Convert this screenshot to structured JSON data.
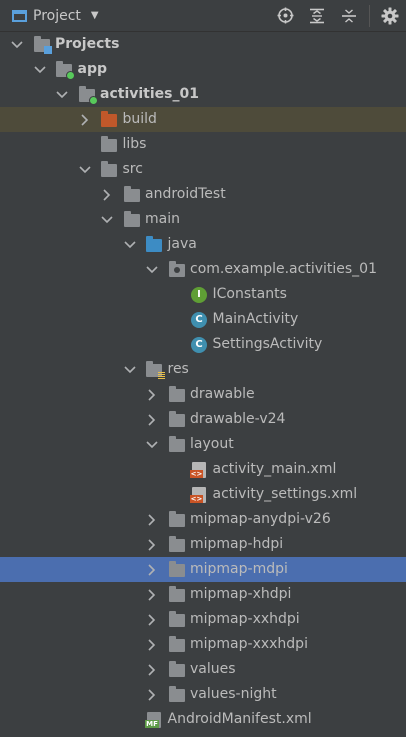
{
  "toolbar": {
    "title": "Project",
    "actions": [
      {
        "name": "locate-icon"
      },
      {
        "name": "expand-all-icon"
      },
      {
        "name": "collapse-all-icon"
      },
      {
        "name": "gear-icon"
      }
    ]
  },
  "tree": [
    {
      "label": "Projects",
      "depth": 0,
      "icon": "project-folder-icon",
      "chevron": "down",
      "bold": true
    },
    {
      "label": "app",
      "depth": 1,
      "icon": "module-folder-icon",
      "chevron": "down",
      "bold": true
    },
    {
      "label": "activities_01",
      "depth": 2,
      "icon": "module-folder-icon",
      "chevron": "down",
      "bold": true
    },
    {
      "label": "build",
      "depth": 3,
      "icon": "excluded-folder-icon",
      "chevron": "right",
      "state": "muted"
    },
    {
      "label": "libs",
      "depth": 3,
      "icon": "folder-icon",
      "chevron": "none"
    },
    {
      "label": "src",
      "depth": 3,
      "icon": "folder-icon",
      "chevron": "down"
    },
    {
      "label": "androidTest",
      "depth": 4,
      "icon": "folder-icon",
      "chevron": "right"
    },
    {
      "label": "main",
      "depth": 4,
      "icon": "folder-icon",
      "chevron": "down"
    },
    {
      "label": "java",
      "depth": 5,
      "icon": "source-folder-icon",
      "chevron": "down"
    },
    {
      "label": "com.example.activities_01",
      "depth": 6,
      "icon": "package-icon",
      "chevron": "down"
    },
    {
      "label": "IConstants",
      "depth": 7,
      "icon": "interface-icon",
      "chevron": "none"
    },
    {
      "label": "MainActivity",
      "depth": 7,
      "icon": "class-icon",
      "chevron": "none"
    },
    {
      "label": "SettingsActivity",
      "depth": 7,
      "icon": "class-icon",
      "chevron": "none"
    },
    {
      "label": "res",
      "depth": 5,
      "icon": "resource-folder-icon",
      "chevron": "down"
    },
    {
      "label": "drawable",
      "depth": 6,
      "icon": "folder-icon",
      "chevron": "right"
    },
    {
      "label": "drawable-v24",
      "depth": 6,
      "icon": "folder-icon",
      "chevron": "right"
    },
    {
      "label": "layout",
      "depth": 6,
      "icon": "folder-icon",
      "chevron": "down"
    },
    {
      "label": "activity_main.xml",
      "depth": 7,
      "icon": "xml-file-icon",
      "chevron": "none"
    },
    {
      "label": "activity_settings.xml",
      "depth": 7,
      "icon": "xml-file-icon",
      "chevron": "none"
    },
    {
      "label": "mipmap-anydpi-v26",
      "depth": 6,
      "icon": "folder-icon",
      "chevron": "right"
    },
    {
      "label": "mipmap-hdpi",
      "depth": 6,
      "icon": "folder-icon",
      "chevron": "right"
    },
    {
      "label": "mipmap-mdpi",
      "depth": 6,
      "icon": "folder-icon",
      "chevron": "right",
      "state": "selected"
    },
    {
      "label": "mipmap-xhdpi",
      "depth": 6,
      "icon": "folder-icon",
      "chevron": "right"
    },
    {
      "label": "mipmap-xxhdpi",
      "depth": 6,
      "icon": "folder-icon",
      "chevron": "right"
    },
    {
      "label": "mipmap-xxxhdpi",
      "depth": 6,
      "icon": "folder-icon",
      "chevron": "right"
    },
    {
      "label": "values",
      "depth": 6,
      "icon": "folder-icon",
      "chevron": "right"
    },
    {
      "label": "values-night",
      "depth": 6,
      "icon": "folder-icon",
      "chevron": "right"
    },
    {
      "label": "AndroidManifest.xml",
      "depth": 5,
      "icon": "manifest-file-icon",
      "chevron": "none"
    }
  ],
  "colors": {
    "background": "#3c3f41",
    "selection": "#4b6eaf",
    "excluded_row": "#4e4b3a",
    "text": "#bbbbbb"
  }
}
